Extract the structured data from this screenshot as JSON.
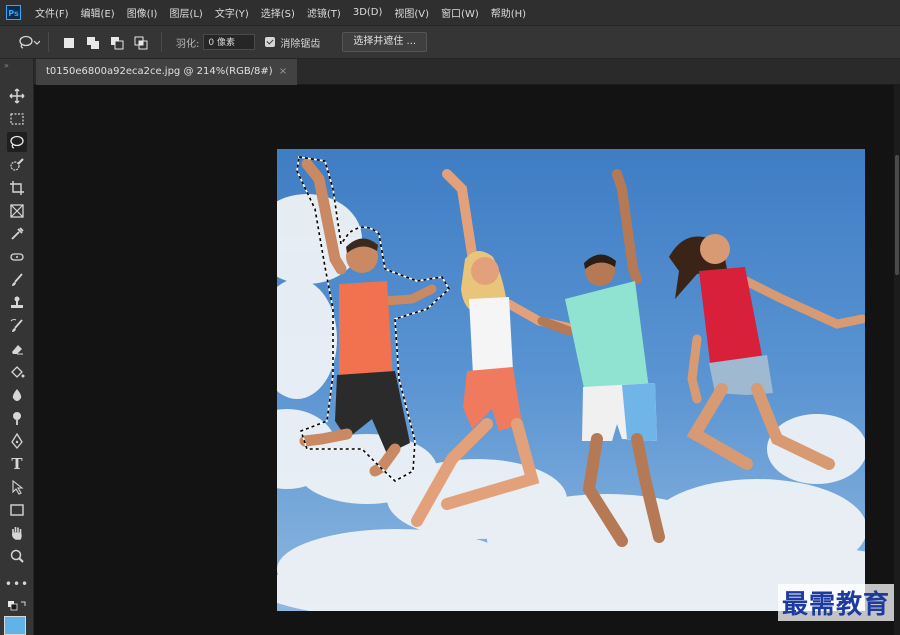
{
  "app": {
    "logo": "Ps"
  },
  "menu": [
    "文件(F)",
    "编辑(E)",
    "图像(I)",
    "图层(L)",
    "文字(Y)",
    "选择(S)",
    "滤镜(T)",
    "3D(D)",
    "视图(V)",
    "窗口(W)",
    "帮助(H)"
  ],
  "options": {
    "feather_label": "羽化:",
    "feather_value": "0 像素",
    "antialias_label": "消除锯齿",
    "select_mask_button": "选择并遮住 ..."
  },
  "document": {
    "tab_title": "t0150e6800a92eca2ce.jpg @ 214%(RGB/8#)",
    "close_symbol": "×"
  },
  "toolbar": {
    "active_tool": "lasso-tool",
    "tools": [
      "move-tool",
      "marquee-tool",
      "lasso-tool",
      "quick-select-tool",
      "crop-tool",
      "frame-tool",
      "eyedropper-tool",
      "healing-tool",
      "brush-tool",
      "stamp-tool",
      "history-brush-tool",
      "eraser-tool",
      "paint-bucket-tool",
      "blur-tool",
      "dodge-tool",
      "pen-tool",
      "type-tool",
      "path-select-tool",
      "rectangle-tool",
      "hand-tool",
      "zoom-tool",
      "more-tools"
    ]
  },
  "colors": {
    "sky": "#4a86c8",
    "accent": "#31a8ff"
  },
  "watermark": "最需教育"
}
